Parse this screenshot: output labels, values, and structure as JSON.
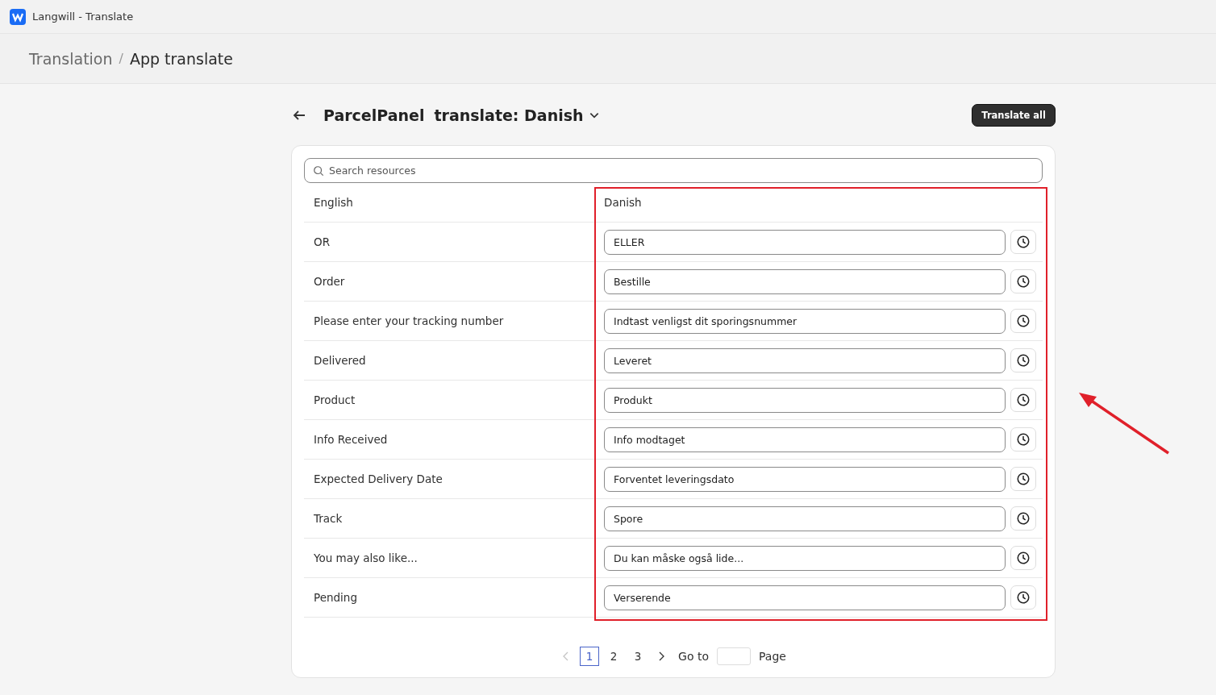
{
  "window": {
    "title": "Langwill - Translate"
  },
  "breadcrumb_separator": "/",
  "breadcrumb": [
    {
      "label": "Translation"
    },
    {
      "label": "App translate"
    }
  ],
  "header": {
    "app_name": "ParcelPanel",
    "language_label": "translate: Danish",
    "action": "Translate all"
  },
  "search": {
    "placeholder": "Search resources"
  },
  "table": {
    "columns": [
      "English",
      "Danish"
    ],
    "rows": [
      {
        "source": "OR",
        "translation": "ELLER"
      },
      {
        "source": "Order",
        "translation": "Bestille"
      },
      {
        "source": "Please enter your tracking number",
        "translation": "Indtast venligst dit sporingsnummer"
      },
      {
        "source": "Delivered",
        "translation": "Leveret"
      },
      {
        "source": "Product",
        "translation": "Produkt"
      },
      {
        "source": "Info Received",
        "translation": "Info modtaget"
      },
      {
        "source": "Expected Delivery Date",
        "translation": "Forventet leveringsdato"
      },
      {
        "source": "Track",
        "translation": "Spore"
      },
      {
        "source": "You may also like...",
        "translation": "Du kan måske også lide..."
      },
      {
        "source": "Pending",
        "translation": "Verserende"
      }
    ]
  },
  "pagination": {
    "prev_disabled": true,
    "pages": [
      {
        "label": "1",
        "selected": true
      },
      {
        "label": "2",
        "selected": false
      },
      {
        "label": "3",
        "selected": false
      }
    ],
    "goto_label": "Go to",
    "page_label": "Page"
  }
}
